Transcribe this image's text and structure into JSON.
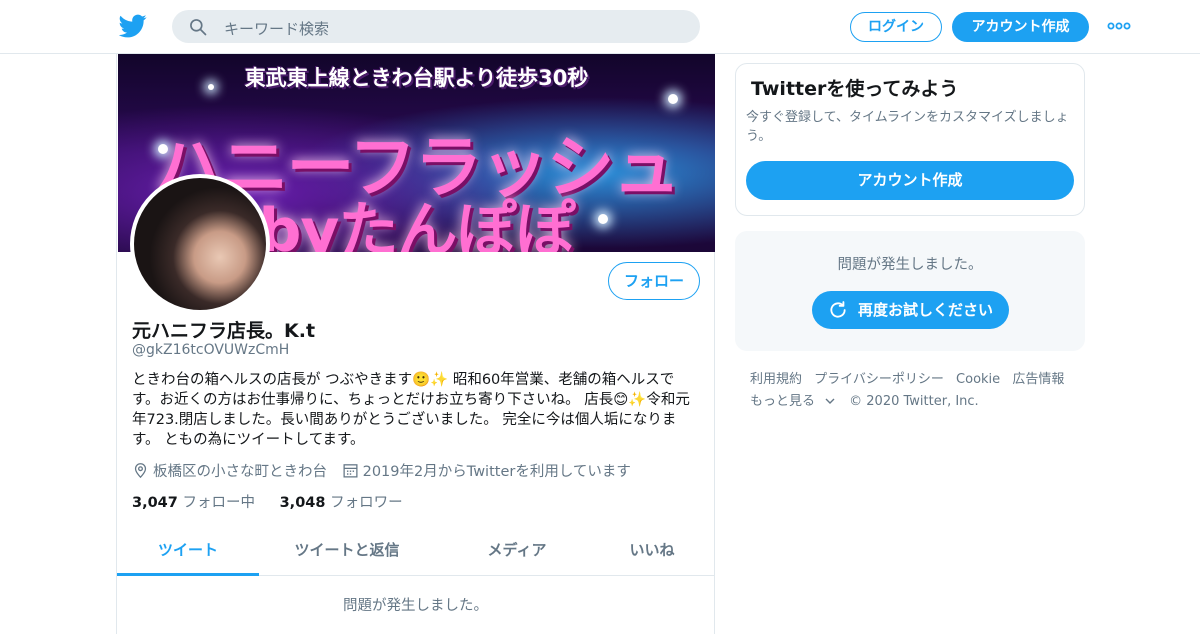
{
  "header": {
    "search_placeholder": "キーワード検索",
    "login_label": "ログイン",
    "signup_label": "アカウント作成"
  },
  "banner": {
    "line1": "東武東上線ときわ台駅より徒歩30秒",
    "line2": "ハニーフラッシュ",
    "line3": "byたんぽぽ"
  },
  "profile": {
    "name": "元ハニフラ店長。K.t",
    "handle": "@gkZ16tcOVUWzCmH",
    "follow_label": "フォロー",
    "bio": "ときわ台の箱ヘルスの店長が つぶやきます🙂✨ 昭和60年営業、老舗の箱ヘルスです。お近くの方はお仕事帰りに、ちょっとだけお立ち寄り下さいね。 店長😊✨令和元年723.閉店しました。長い間ありがとうございました。 完全に今は個人垢になります。 ともの為にツイートしてます。",
    "location": "板橋区の小さな町ときわ台",
    "joined": "2019年2月からTwitterを利用しています",
    "following_count": "3,047",
    "following_label": "フォロー中",
    "followers_count": "3,048",
    "followers_label": "フォロワー"
  },
  "tabs": [
    {
      "label": "ツイート",
      "active": true
    },
    {
      "label": "ツイートと返信",
      "active": false
    },
    {
      "label": "メディア",
      "active": false
    },
    {
      "label": "いいね",
      "active": false
    }
  ],
  "timeline": {
    "error_text": "問題が発生しました。"
  },
  "sidebar": {
    "signup_card": {
      "title": "Twitterを使ってみよう",
      "description": "今すぐ登録して、タイムラインをカスタマイズしましょう。",
      "button_label": "アカウント作成"
    },
    "error_card": {
      "text": "問題が発生しました。",
      "retry_label": "再度お試しください"
    },
    "footer": {
      "links": [
        "利用規約",
        "プライバシーポリシー",
        "Cookie",
        "広告情報"
      ],
      "more_label": "もっと見る",
      "copyright": "© 2020 Twitter, Inc."
    }
  },
  "colors": {
    "accent": "#1da1f2",
    "text_secondary": "#657786",
    "border": "#e1e8ed",
    "banner_text": "#ff6fd2"
  }
}
